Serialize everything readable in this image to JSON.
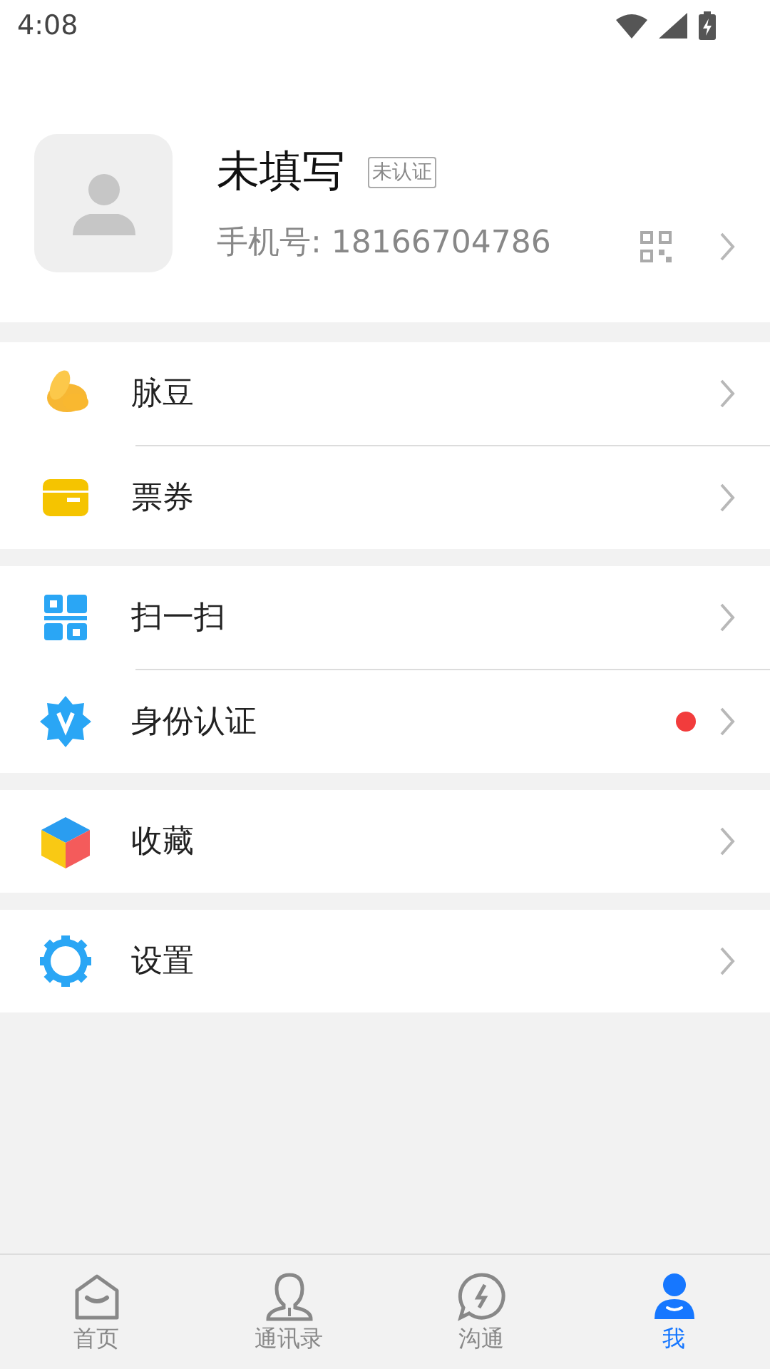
{
  "status_bar": {
    "time": "4:08"
  },
  "profile": {
    "name": "未填写",
    "badge": "未认证",
    "phone": "手机号: 18166704786"
  },
  "menu_groups": [
    {
      "items": [
        {
          "label": "脉豆",
          "dot": false
        },
        {
          "label": "票券",
          "dot": false
        }
      ]
    },
    {
      "items": [
        {
          "label": "扫一扫",
          "dot": false
        },
        {
          "label": "身份认证",
          "dot": true
        }
      ]
    },
    {
      "items": [
        {
          "label": "收藏",
          "dot": false
        }
      ]
    },
    {
      "items": [
        {
          "label": "设置",
          "dot": false
        }
      ]
    }
  ],
  "tabs": [
    {
      "label": "首页",
      "selected": false
    },
    {
      "label": "通讯录",
      "selected": false
    },
    {
      "label": "沟通",
      "selected": false
    },
    {
      "label": "我",
      "selected": true
    }
  ]
}
